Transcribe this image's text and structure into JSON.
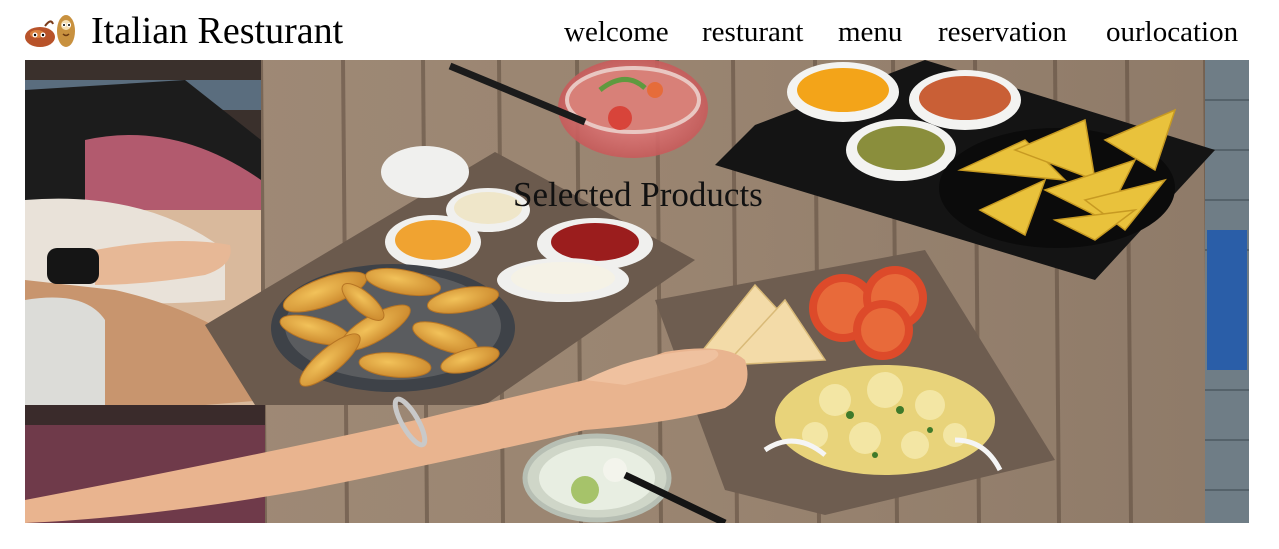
{
  "header": {
    "logo_icon": "potato-mascot-icon",
    "brand": "Italian Resturant"
  },
  "nav": {
    "items": [
      {
        "label": "welcome"
      },
      {
        "label": "resturant"
      },
      {
        "label": "menu"
      },
      {
        "label": "reservation"
      },
      {
        "label": "ourlocation"
      }
    ]
  },
  "hero": {
    "title": "Selected Products",
    "image_subject": "food-table-photo"
  },
  "colors": {
    "background": "#ffffff",
    "text": "#000000",
    "wood": "#9c8774",
    "tray_brown": "#6f5e52",
    "tray_black": "#161616",
    "chips": "#e8c13a",
    "potato_wedges": "#e0a93c"
  }
}
